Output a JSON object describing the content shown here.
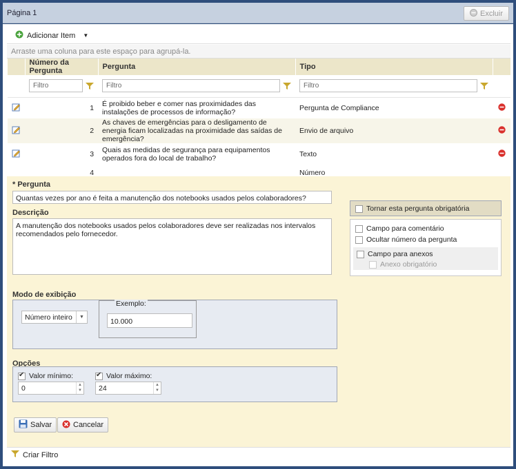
{
  "window": {
    "title": "Página 1",
    "delete_label": "Excluir"
  },
  "toolbar": {
    "add_item_label": "Adicionar Item"
  },
  "group_hint": "Arraste uma coluna para este espaço para agrupá-la.",
  "grid": {
    "columns": [
      "Número da Pergunta",
      "Pergunta",
      "Tipo"
    ],
    "filter_placeholder": "Filtro",
    "rows": [
      {
        "num": "1",
        "question": "É proibido beber e comer nas proximidades das instalações de processos de informação?",
        "type": "Pergunta de Compliance"
      },
      {
        "num": "2",
        "question": "As chaves de emergências para o desligamento de energia ficam localizadas na proximidade das saídas de emergência?",
        "type": "Envio de arquivo"
      },
      {
        "num": "3",
        "question": "Quais as medidas de segurança para equipamentos operados fora do local de trabalho?",
        "type": "Texto"
      },
      {
        "num": "4",
        "question": "",
        "type": "Número"
      }
    ]
  },
  "form": {
    "question_label": "* Pergunta",
    "question_value": "Quantas vezes por ano é feita a manutenção dos notebooks usados pelos colaboradores?",
    "description_label": "Descrição",
    "description_value": "A manutenção dos notebooks usados pelos colaboradores deve ser realizadas nos intervalos recomendados pelo fornecedor.",
    "mandatory_label": "Tornar esta pergunta obrigatória",
    "comment_field_label": "Campo para comentário",
    "hide_number_label": "Ocultar número da pergunta",
    "attachments_label": "Campo para anexos",
    "attachment_required_label": "Anexo obrigatório",
    "display_mode_label": "Modo de exibição",
    "display_mode_value": "Número inteiro",
    "example_label": "Exemplo:",
    "example_value": "10.000",
    "options_label": "Opções",
    "min_label": "Valor mínimo:",
    "min_value": "0",
    "max_label": "Valor máximo:",
    "max_value": "24",
    "save_label": "Salvar",
    "cancel_label": "Cancelar"
  },
  "footer": {
    "create_filter_label": "Criar Filtro"
  },
  "colors": {
    "frame": "#2f4e7c",
    "header_bg": "#ece6c9",
    "form_bg": "#fbf4d6",
    "delete_red": "#d9302c"
  }
}
